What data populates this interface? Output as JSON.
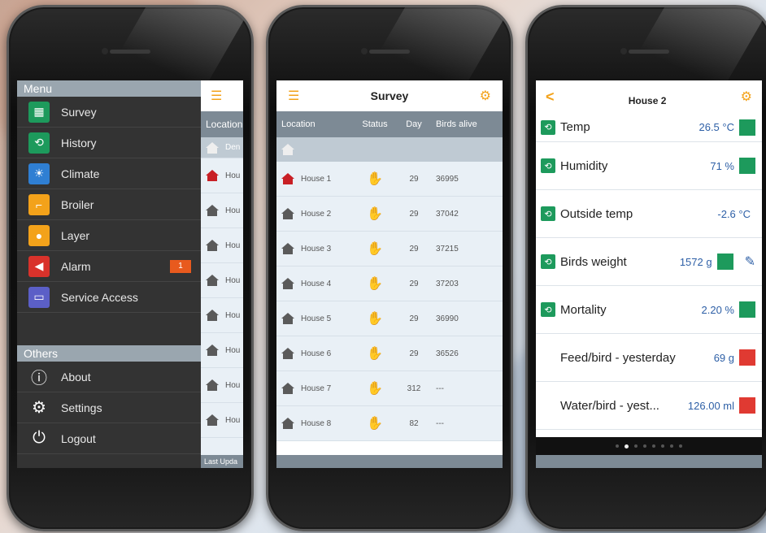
{
  "menu": {
    "section_title": "Menu",
    "items": [
      {
        "label": "Survey",
        "icon": "table-icon",
        "color": "#1d9a5c"
      },
      {
        "label": "History",
        "icon": "history-icon",
        "color": "#1d9a5c"
      },
      {
        "label": "Climate",
        "icon": "climate-icon",
        "color": "#2f7fd3"
      },
      {
        "label": "Broiler",
        "icon": "broiler-icon",
        "color": "#f3a21a"
      },
      {
        "label": "Layer",
        "icon": "egg-icon",
        "color": "#f3a21a"
      },
      {
        "label": "Alarm",
        "icon": "speaker-icon",
        "color": "#d9322b",
        "badge": "1"
      },
      {
        "label": "Service Access",
        "icon": "service-icon",
        "color": "#5b5fc7"
      }
    ],
    "others_title": "Others",
    "others": [
      {
        "label": "About",
        "icon": "info-icon"
      },
      {
        "label": "Settings",
        "icon": "gear-icon"
      },
      {
        "label": "Logout",
        "icon": "power-icon"
      }
    ],
    "peek_header": "Location",
    "peek_group": "Den",
    "peek_rows": [
      "Hou",
      "Hou",
      "Hou",
      "Hou",
      "Hou",
      "Hou",
      "Hou",
      "Hou"
    ],
    "peek_footer": "Last Upda"
  },
  "survey": {
    "title": "Survey",
    "columns": [
      "Location",
      "Status",
      "Day",
      "Birds alive"
    ],
    "rows": [
      {
        "location": "House 1",
        "day": "29",
        "birds": "36995",
        "alert": true
      },
      {
        "location": "House 2",
        "day": "29",
        "birds": "37042",
        "alert": false
      },
      {
        "location": "House 3",
        "day": "29",
        "birds": "37215",
        "alert": false
      },
      {
        "location": "House 4",
        "day": "29",
        "birds": "37203",
        "alert": false
      },
      {
        "location": "House 5",
        "day": "29",
        "birds": "36990",
        "alert": false
      },
      {
        "location": "House 6",
        "day": "29",
        "birds": "36526",
        "alert": false
      },
      {
        "location": "House 7",
        "day": "312",
        "birds": "---",
        "alert": false
      },
      {
        "location": "House 8",
        "day": "82",
        "birds": "---",
        "alert": false
      }
    ]
  },
  "house": {
    "title": "House 2",
    "rows": [
      {
        "label": "Temp",
        "value": "26.5 °C",
        "status": "#1d9a5c",
        "history": true
      },
      {
        "label": "Humidity",
        "value": "71 %",
        "status": "#1d9a5c",
        "history": true
      },
      {
        "label": "Outside temp",
        "value": "-2.6 °C",
        "status": "",
        "history": true
      },
      {
        "label": "Birds weight",
        "value": "1572 g",
        "status": "#1d9a5c",
        "history": true,
        "editable": true
      },
      {
        "label": "Mortality",
        "value": "2.20 %",
        "status": "#1d9a5c",
        "history": true
      },
      {
        "label": "Feed/bird - yesterday",
        "value": "69 g",
        "status": "#e03a32",
        "history": false
      },
      {
        "label": "Water/bird - yest...",
        "value": "126.00 ml",
        "status": "#e03a32",
        "history": false
      }
    ],
    "page_count": 8,
    "active_page": 1
  },
  "colors": {
    "accent": "#f3a21a",
    "ok": "#1d9a5c",
    "alert": "#e03a32",
    "value": "#2d5fa6"
  }
}
